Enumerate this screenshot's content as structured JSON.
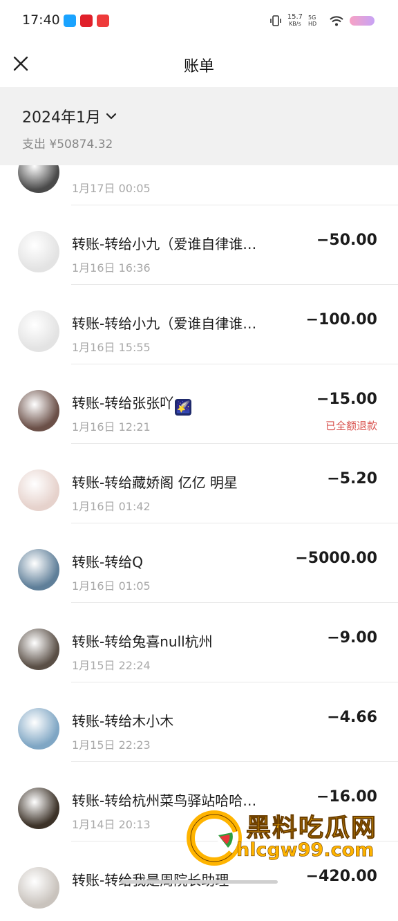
{
  "status_bar": {
    "time": "17:40",
    "net_speed_value": "15.7",
    "net_speed_unit": "KB/s",
    "network": "5G HD"
  },
  "header": {
    "title": "账单"
  },
  "filter": {
    "month": "2024年1月",
    "total": "支出 ¥50874.32"
  },
  "transactions": [
    {
      "title": "",
      "date": "1月17日 00:05",
      "amount": "",
      "status": "",
      "avatar_color": "#4a4a4a"
    },
    {
      "title": "转账-转给小九（爱谁自律谁…",
      "date": "1月16日 16:36",
      "amount": "−50.00",
      "status": "",
      "avatar_color": "#e3e3e3"
    },
    {
      "title": "转账-转给小九（爱谁自律谁…",
      "date": "1月16日 15:55",
      "amount": "−100.00",
      "status": "",
      "avatar_color": "#e3e3e3"
    },
    {
      "title": "转账-转给张张吖",
      "date": "1月16日 12:21",
      "amount": "−15.00",
      "status": "已全额退款",
      "avatar_color": "#6b5048",
      "emoji": "🌠"
    },
    {
      "title": "转账-转给藏娇阁 亿亿 明星",
      "date": "1月16日 01:42",
      "amount": "−5.20",
      "status": "",
      "avatar_color": "#e6d2cc"
    },
    {
      "title": "转账-转给Q",
      "date": "1月16日 01:05",
      "amount": "−5000.00",
      "status": "",
      "avatar_color": "#5f7f99"
    },
    {
      "title": "转账-转给兔喜null杭州",
      "date": "1月15日 22:24",
      "amount": "−9.00",
      "status": "",
      "avatar_color": "#5a4f46"
    },
    {
      "title": "转账-转给木小木",
      "date": "1月15日 22:23",
      "amount": "−4.66",
      "status": "",
      "avatar_color": "#7fa6c4"
    },
    {
      "title": "转账-转给杭州菜鸟驿站哈哈…",
      "date": "1月14日 20:13",
      "amount": "−16.00",
      "status": "",
      "avatar_color": "#3c3228"
    },
    {
      "title": "转账-转给我是周院长助理",
      "date": "",
      "amount": "−420.00",
      "status": "",
      "avatar_color": "#c9c3bd"
    }
  ],
  "watermark": {
    "line1": "黑料吃瓜网",
    "line2": "hlcgw99.com"
  }
}
